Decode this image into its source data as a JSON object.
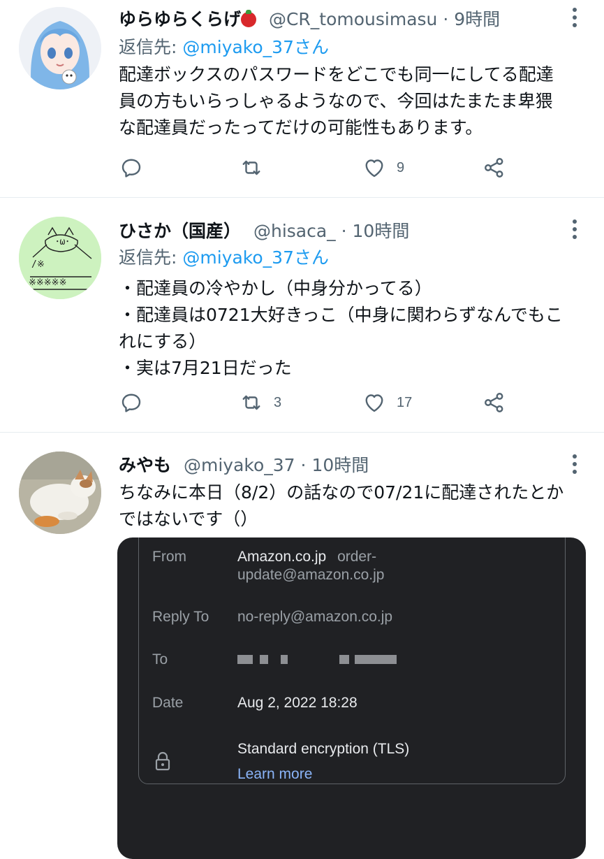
{
  "tweets": [
    {
      "display_name": "ゆらゆらくらげ",
      "emoji_icon": "tomato-emoji",
      "handle": "@CR_tomousimasu",
      "time": "9時間",
      "reply_prefix": "返信先:",
      "reply_user": "@miyako_37さん",
      "text_lines": [
        "配達ボックスのパスワードをどこでも同一にしてる配達",
        "員の方もいらっしゃるようなので、今回はたまたま卑猥",
        "な配達員だったってだけの可能性もあります。"
      ],
      "counts": {
        "reply": "",
        "retweet": "",
        "like": "9"
      }
    },
    {
      "display_name": "ひさか（国産）",
      "handle": "@hisaca_",
      "time": "10時間",
      "reply_prefix": "返信先:",
      "reply_user": "@miyako_37さん",
      "text_lines": [
        "・配達員の冷やかし（中身分かってる）",
        "・配達員は0721大好きっこ（中身に関わらずなんでもこ",
        "れにする）",
        "・実は7月21日だった"
      ],
      "counts": {
        "reply": "",
        "retweet": "3",
        "like": "17"
      }
    },
    {
      "display_name": "みやも",
      "handle": "@miyako_37",
      "time": "10時間",
      "text_lines": [
        "ちなみに本日（8/2）の話なので07/21に配達されたとか",
        "ではないです（）"
      ],
      "email": {
        "from_label": "From",
        "from_name": "Amazon.co.jp",
        "from_address_line1": "order-",
        "from_address_line2": "update@amazon.co.jp",
        "reply_to_label": "Reply To",
        "reply_to_value": "no-reply@amazon.co.jp",
        "to_label": "To",
        "date_label": "Date",
        "date_value": "Aug 2, 2022 18:28",
        "encryption_text": "Standard encryption (TLS)",
        "learn_more": "Learn more"
      }
    }
  ],
  "dot": "·",
  "colors": {
    "text": "#0f1419",
    "secondary": "#536471",
    "link": "#1d9bf0",
    "divider": "#e6ecf0",
    "card_bg": "#202124",
    "card_link": "#8ab4f8"
  },
  "icons": [
    "more-icon",
    "reply-icon",
    "retweet-icon",
    "like-icon",
    "share-icon",
    "lock-icon"
  ]
}
